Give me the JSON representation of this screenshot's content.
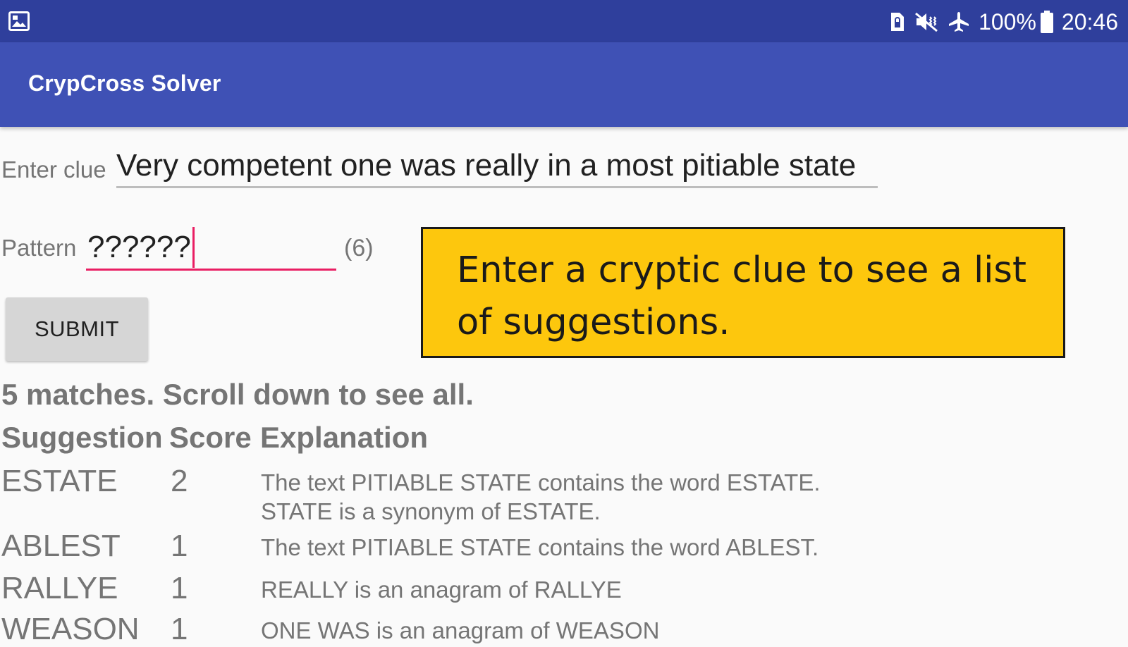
{
  "status_bar": {
    "left_icon": "gallery-icon",
    "icons": [
      "sim-lock-icon",
      "vibrate-mute-icon",
      "airplane-mode-icon",
      "battery-icon"
    ],
    "battery": "100%",
    "time": "20:46"
  },
  "app_bar": {
    "title": "CrypCross Solver"
  },
  "clue": {
    "label": "Enter clue",
    "value": "Very competent one was really in a most pitiable state"
  },
  "pattern": {
    "label": "Pattern",
    "value": "??????",
    "length": "(6)"
  },
  "submit": {
    "label": "SUBMIT"
  },
  "tooltip": {
    "text": "Enter a cryptic clue to see a list of suggestions."
  },
  "results": {
    "summary": "5 matches. Scroll down to see all.",
    "columns": [
      "Suggestion",
      "Score",
      "Explanation"
    ],
    "rows": [
      {
        "suggestion": "ESTATE",
        "score": "2",
        "explanation": "The text PITIABLE STATE contains the word ESTATE. STATE is a synonym of ESTATE."
      },
      {
        "suggestion": "ABLEST",
        "score": "1",
        "explanation": "The text PITIABLE STATE contains the word ABLEST."
      },
      {
        "suggestion": "RALLYE",
        "score": "1",
        "explanation": "REALLY is an anagram of RALLYE"
      },
      {
        "suggestion": "WEASON",
        "score": "1",
        "explanation": "ONE WAS is an anagram of WEASON"
      }
    ]
  },
  "colors": {
    "status_bar": "#2f3f9c",
    "app_bar": "#3f51b5",
    "accent": "#e91e63",
    "tooltip_bg": "#fdc70d"
  }
}
